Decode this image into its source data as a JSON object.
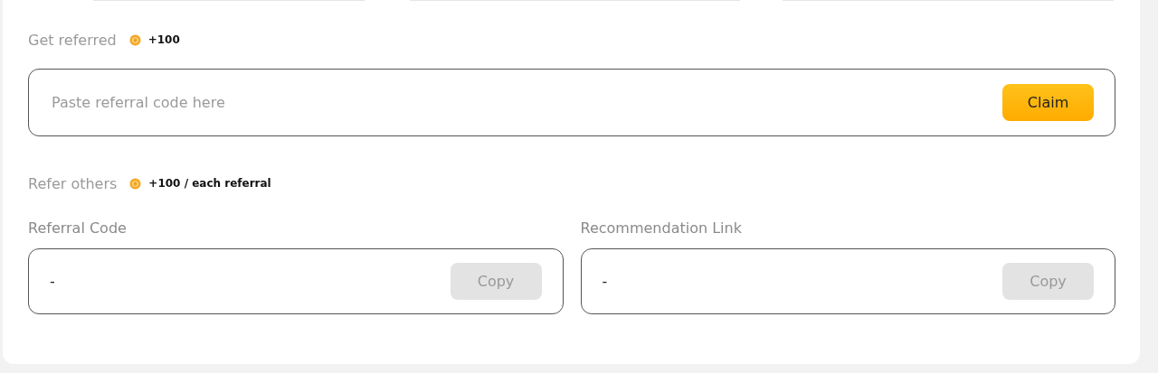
{
  "get_referred": {
    "title": "Get referred",
    "reward": "+100",
    "input": {
      "placeholder": "Paste referral code here"
    },
    "button": {
      "label": "Claim",
      "disabled": false
    }
  },
  "refer_others": {
    "title": "Refer others",
    "reward": "+100 / each referral",
    "fields": [
      {
        "label": "Referral Code",
        "value": "-",
        "button": {
          "label": "Copy",
          "disabled": true
        }
      },
      {
        "label": "Recommendation Link",
        "value": "-",
        "button": {
          "label": "Copy",
          "disabled": true
        }
      }
    ]
  }
}
